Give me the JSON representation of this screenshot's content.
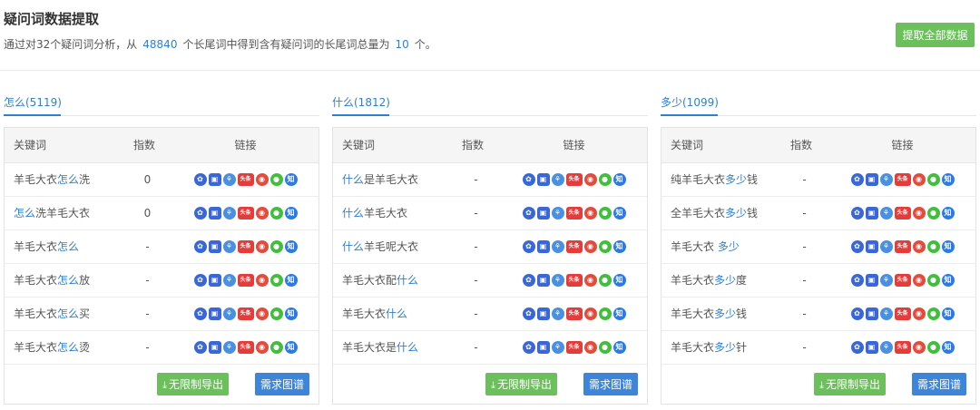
{
  "header": {
    "title": "疑问词数据提取",
    "summary_prefix": "通过对32个疑问词分析，从",
    "total_words": "48840",
    "summary_middle": "个长尾词中得到含有疑问词的长尾词总量为",
    "result_count": "10",
    "summary_suffix": "个。",
    "extract_all_label": "提取全部数据"
  },
  "table_headers": {
    "keyword": "关键词",
    "index": "指数",
    "links": "链接"
  },
  "buttons": {
    "export_label": "无限制导出",
    "atlas_label": "需求图谱"
  },
  "link_icons": [
    {
      "name": "baidu-icon",
      "glyph": "✿"
    },
    {
      "name": "baidu-wenku-icon",
      "glyph": "▣"
    },
    {
      "name": "so360-icon",
      "glyph": "⚘"
    },
    {
      "name": "toutiao-icon",
      "glyph": "头条"
    },
    {
      "name": "weibo-icon",
      "glyph": "◉"
    },
    {
      "name": "wechat-icon",
      "glyph": "●"
    },
    {
      "name": "zhihu-icon",
      "glyph": "知"
    }
  ],
  "colors": {
    "accent": "#2f7fd1",
    "green": "#6cc05b",
    "blue_button": "#3d85d8"
  },
  "columns": [
    {
      "tab": "怎么(5119)",
      "rows": [
        {
          "pre": "羊毛大衣",
          "hl": "怎么",
          "post": "洗",
          "index": "0"
        },
        {
          "pre": "",
          "hl": "怎么",
          "post": "洗羊毛大衣",
          "index": "0"
        },
        {
          "pre": "羊毛大衣",
          "hl": "怎么",
          "post": "",
          "index": "-"
        },
        {
          "pre": "羊毛大衣",
          "hl": "怎么",
          "post": "放",
          "index": "-"
        },
        {
          "pre": "羊毛大衣",
          "hl": "怎么",
          "post": "买",
          "index": "-"
        },
        {
          "pre": "羊毛大衣",
          "hl": "怎么",
          "post": "烫",
          "index": "-"
        }
      ]
    },
    {
      "tab": "什么(1812)",
      "rows": [
        {
          "pre": "",
          "hl": "什么",
          "post": "是羊毛大衣",
          "index": "-"
        },
        {
          "pre": "",
          "hl": "什么",
          "post": "羊毛大衣",
          "index": "-"
        },
        {
          "pre": "",
          "hl": "什么",
          "post": "羊毛呢大衣",
          "index": "-"
        },
        {
          "pre": "羊毛大衣配",
          "hl": "什么",
          "post": "",
          "index": "-"
        },
        {
          "pre": "羊毛大衣",
          "hl": "什么",
          "post": "",
          "index": "-"
        },
        {
          "pre": "羊毛大衣是",
          "hl": "什么",
          "post": "",
          "index": "-"
        }
      ]
    },
    {
      "tab": "多少(1099)",
      "rows": [
        {
          "pre": "纯羊毛大衣",
          "hl": "多少",
          "post": "钱",
          "index": "-"
        },
        {
          "pre": "全羊毛大衣",
          "hl": "多少",
          "post": "钱",
          "index": "-"
        },
        {
          "pre": "羊毛大衣 ",
          "hl": "多少",
          "post": "",
          "index": "-"
        },
        {
          "pre": "羊毛大衣",
          "hl": "多少",
          "post": "度",
          "index": "-"
        },
        {
          "pre": "羊毛大衣",
          "hl": "多少",
          "post": "钱",
          "index": "-"
        },
        {
          "pre": "羊毛大衣",
          "hl": "多少",
          "post": "针",
          "index": "-"
        }
      ]
    }
  ]
}
